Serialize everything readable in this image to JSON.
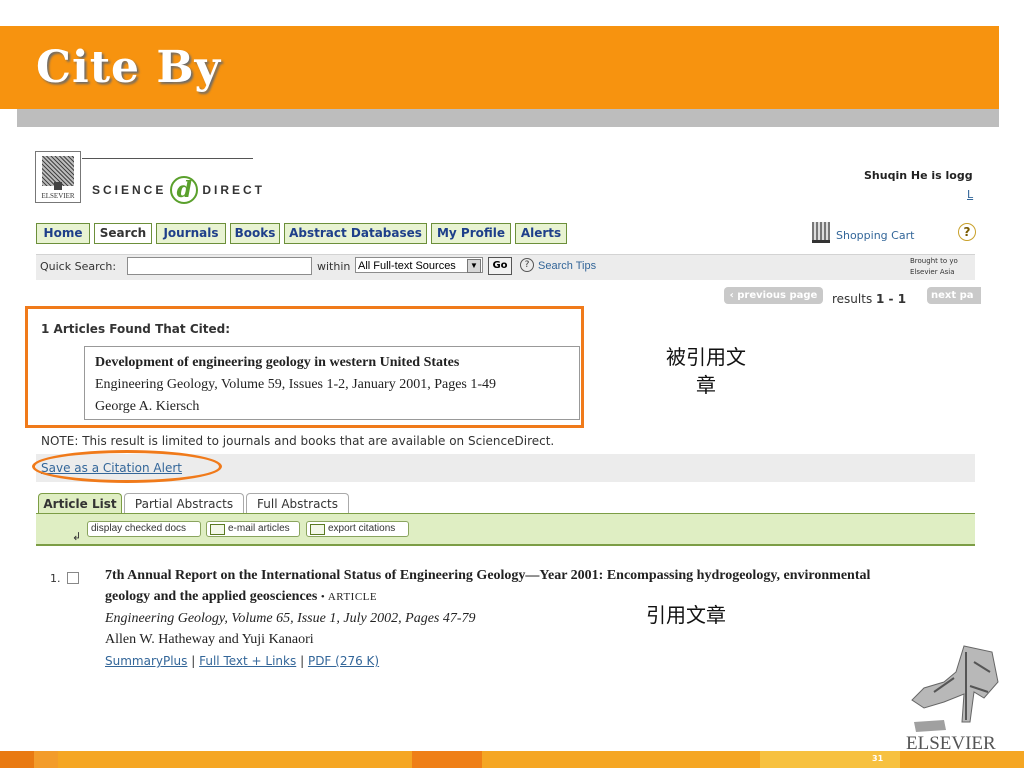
{
  "slide": {
    "title": "Cite By",
    "page_number": "31"
  },
  "logo": {
    "elsevier": "ELSEVIER",
    "science": "SCIENCE",
    "direct": "DIRECT",
    "d": "d"
  },
  "user": {
    "status": "Shuqin He is logg",
    "logout": "L"
  },
  "nav": {
    "tabs": [
      "Home",
      "Search",
      "Journals",
      "Books",
      "Abstract Databases",
      "My Profile",
      "Alerts"
    ],
    "active": "Search",
    "cart": "Shopping Cart",
    "help": "?"
  },
  "quick_search": {
    "label": "Quick Search:",
    "value": "",
    "within": "within",
    "source": "All Full-text Sources",
    "go": "Go",
    "tips": "Search Tips",
    "brought_1": "Brought to yo",
    "brought_2": "Elsevier Asia"
  },
  "pagination": {
    "previous": "‹ previous page",
    "results_prefix": "results",
    "results_range": "1 - 1",
    "next": "next pa"
  },
  "cited": {
    "heading": "1 Articles Found That Cited:",
    "title": "Development of engineering geology in western United States",
    "source": "Engineering Geology, Volume 59, Issues 1-2, January 2001, Pages 1-49",
    "author": "George A. Kiersch",
    "callout_1": "被引用文",
    "callout_2": "章"
  },
  "note": "NOTE: This result is limited to journals and books that are available on ScienceDirect.",
  "save_alert": "Save as a Citation Alert",
  "article_tabs": [
    "Article List",
    "Partial Abstracts",
    "Full Abstracts"
  ],
  "tools": {
    "arrow": "↲",
    "display": "display checked docs",
    "email": "e-mail articles",
    "export": "export citations"
  },
  "result": {
    "number": "1.",
    "title_1": "7th Annual Report on the International Status of Engineering Geology—Year 2001: Encompassing hydrogeology, environmental",
    "title_2": "geology and the applied geosciences",
    "type": "• ARTICLE",
    "source": "Engineering Geology, Volume 65, Issue 1, July 2002, Pages 47-79",
    "authors": "Allen W. Hatheway and Yuji Kanaori",
    "link_summary": "SummaryPlus",
    "link_fulltext": "Full Text + Links",
    "link_pdf": "PDF (276 K)",
    "sep": "|",
    "callout": "引用文章"
  },
  "footer": {
    "brand": "ELSEVIER"
  },
  "colors": {
    "slide_orange": "#f7930f",
    "annotation_orange": "#f07a1a",
    "tab_green": "#dfeec3",
    "link_blue": "#336699"
  }
}
